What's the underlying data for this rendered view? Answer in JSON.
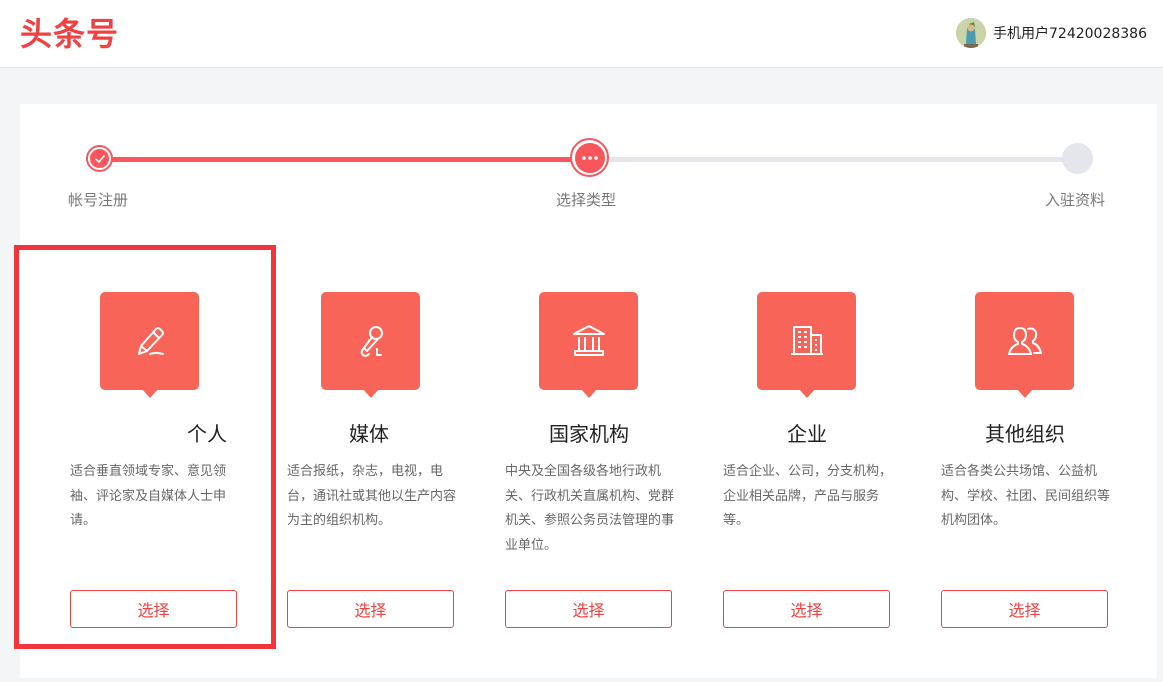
{
  "header": {
    "logo": "头条号",
    "username": "手机用户72420028386"
  },
  "steps": [
    {
      "label": "帐号注册",
      "state": "done"
    },
    {
      "label": "选择类型",
      "state": "current"
    },
    {
      "label": "入驻资料",
      "state": "todo"
    }
  ],
  "types": [
    {
      "title": "个人",
      "desc": "适合垂直领域专家、意见领袖、评论家及自媒体人士申请。",
      "button": "选择",
      "icon": "pencil-icon",
      "selected": true
    },
    {
      "title": "媒体",
      "desc": "适合报纸，杂志，电视，电台，通讯社或其他以生产内容为主的组织机构。",
      "button": "选择",
      "icon": "microphone-icon",
      "selected": false
    },
    {
      "title": "国家机构",
      "desc": "中央及全国各级各地行政机关、行政机关直属机构、党群机关、参照公务员法管理的事业单位。",
      "button": "选择",
      "icon": "government-building-icon",
      "selected": false
    },
    {
      "title": "企业",
      "desc": "适合企业、公司，分支机构，企业相关品牌，产品与服务等。",
      "button": "选择",
      "icon": "office-building-icon",
      "selected": false
    },
    {
      "title": "其他组织",
      "desc": "适合各类公共场馆、公益机构、学校、社团、民间组织等机构团体。",
      "button": "选择",
      "icon": "people-icon",
      "selected": false
    }
  ],
  "colors": {
    "brand": "#f04142",
    "accent": "#f8565b",
    "icon_bg": "#f86458",
    "track_inactive": "#e5e6eb",
    "highlight": "#f2343b"
  }
}
